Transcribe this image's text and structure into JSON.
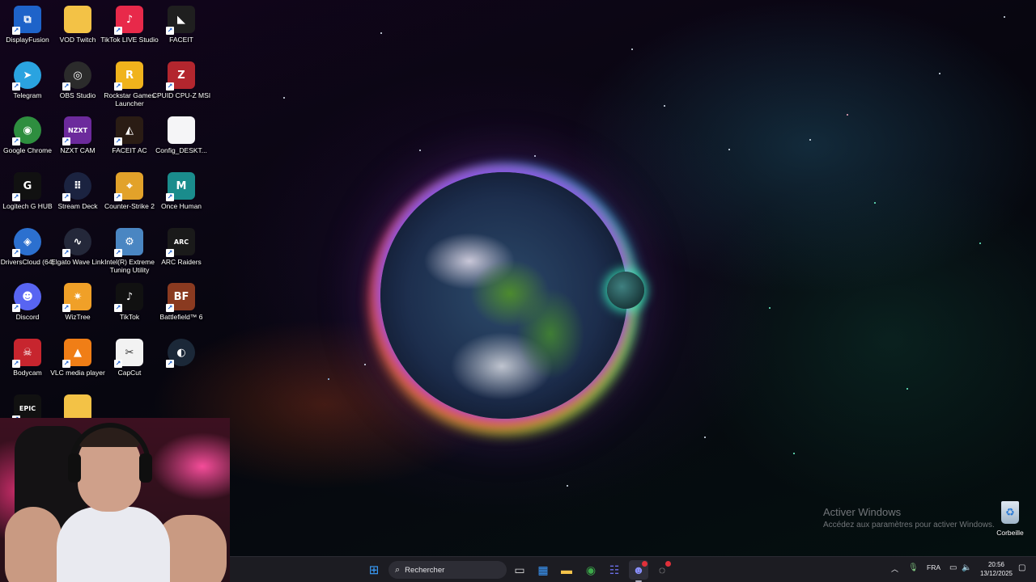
{
  "desktop": {
    "icons": [
      {
        "label": "DisplayFusion",
        "icon": "displayfusion-icon",
        "color": "#1e63c9"
      },
      {
        "label": "VOD Twitch",
        "icon": "folder-icon",
        "color": "#f3c246"
      },
      {
        "label": "TikTok LIVE Studio",
        "icon": "tiktok-live-studio-icon",
        "color": "#e8294a"
      },
      {
        "label": "FACEIT",
        "icon": "faceit-icon",
        "color": "#1f1f1f"
      },
      {
        "label": "Telegram",
        "icon": "telegram-icon",
        "color": "#2aa3e0"
      },
      {
        "label": "OBS Studio",
        "icon": "obs-studio-icon",
        "color": "#2b2b2b"
      },
      {
        "label": "Rockstar Games Launcher",
        "icon": "rockstar-games-icon",
        "color": "#f0b31c"
      },
      {
        "label": "CPUID CPU-Z MSI",
        "icon": "cpu-z-icon",
        "color": "#b3262e"
      },
      {
        "label": "Google Chrome",
        "icon": "chrome-icon",
        "color": "#2e8e3f"
      },
      {
        "label": "NZXT CAM",
        "icon": "nzxt-cam-icon",
        "color": "#6c2a9c"
      },
      {
        "label": "FACEIT AC",
        "icon": "faceit-ac-icon",
        "color": "#2a1c14"
      },
      {
        "label": "Config_DESKT...",
        "icon": "file-icon",
        "color": "#f5f5f7"
      },
      {
        "label": "Logitech G HUB",
        "icon": "logitech-g-hub-icon",
        "color": "#111111"
      },
      {
        "label": "Stream Deck",
        "icon": "stream-deck-icon",
        "color": "#1b2340"
      },
      {
        "label": "Counter-Strike 2",
        "icon": "counter-strike-2-icon",
        "color": "#e2a22a"
      },
      {
        "label": "Once Human",
        "icon": "once-human-icon",
        "color": "#1a8c8c"
      },
      {
        "label": "DriversCloud (64)",
        "icon": "driverscloud-icon",
        "color": "#2c70cf"
      },
      {
        "label": "Elgato Wave Link",
        "icon": "elgato-wave-link-icon",
        "color": "#24283a"
      },
      {
        "label": "Intel(R) Extreme Tuning Utility",
        "icon": "intel-xtu-icon",
        "color": "#4a86c2"
      },
      {
        "label": "ARC Raiders",
        "icon": "arc-raiders-icon",
        "color": "#1a1a1a"
      },
      {
        "label": "Discord",
        "icon": "discord-icon",
        "color": "#5865f2"
      },
      {
        "label": "WizTree",
        "icon": "wiztree-icon",
        "color": "#f0a028"
      },
      {
        "label": "TikTok",
        "icon": "tiktok-icon",
        "color": "#111111"
      },
      {
        "label": "Battlefield™ 6",
        "icon": "battlefield-6-icon",
        "color": "#8a3a20"
      },
      {
        "label": "Bodycam",
        "icon": "bodycam-icon",
        "color": "#c7252e"
      },
      {
        "label": "VLC media player",
        "icon": "vlc-icon",
        "color": "#f07e16"
      },
      {
        "label": "CapCut",
        "icon": "capcut-icon",
        "color": "#f2f2f2"
      },
      {
        "label": "",
        "icon": "steam-icon",
        "color": "#1b2838"
      },
      {
        "label": "",
        "icon": "epic-games-icon",
        "color": "#111111"
      },
      {
        "label": "",
        "icon": "folder-icon",
        "color": "#f3c246"
      }
    ],
    "glyphs": [
      "⧉",
      "",
      "♪",
      "◣",
      "➤",
      "◎",
      "R",
      "Z",
      "◉",
      "NZXT",
      "◭",
      "",
      "G",
      "⠿",
      "⌖",
      "M",
      "◈",
      "∿",
      "⚙",
      "ARC",
      "☻",
      "✷",
      "♪",
      "BF",
      "☠",
      "▲",
      "✂",
      "◐",
      "EPIC",
      ""
    ],
    "recycle_bin": {
      "label": "Corbeille",
      "icon": "recycle-bin-icon"
    },
    "activation": {
      "title": "Activer Windows",
      "subtitle": "Accédez aux paramètres pour activer Windows."
    }
  },
  "taskbar": {
    "search_placeholder": "Rechercher",
    "pinned": [
      "start-icon",
      "task-view-icon",
      "microsoft-store-icon",
      "file-explorer-icon",
      "chrome-icon",
      "teams-icon",
      "discord-icon",
      "app-icon"
    ],
    "tray": {
      "language": "FRA",
      "time": "20:56",
      "date": "13/12/2025"
    }
  },
  "colors": {
    "taskbar_bg": "#1c1c22",
    "accent": "#0a84ff"
  }
}
